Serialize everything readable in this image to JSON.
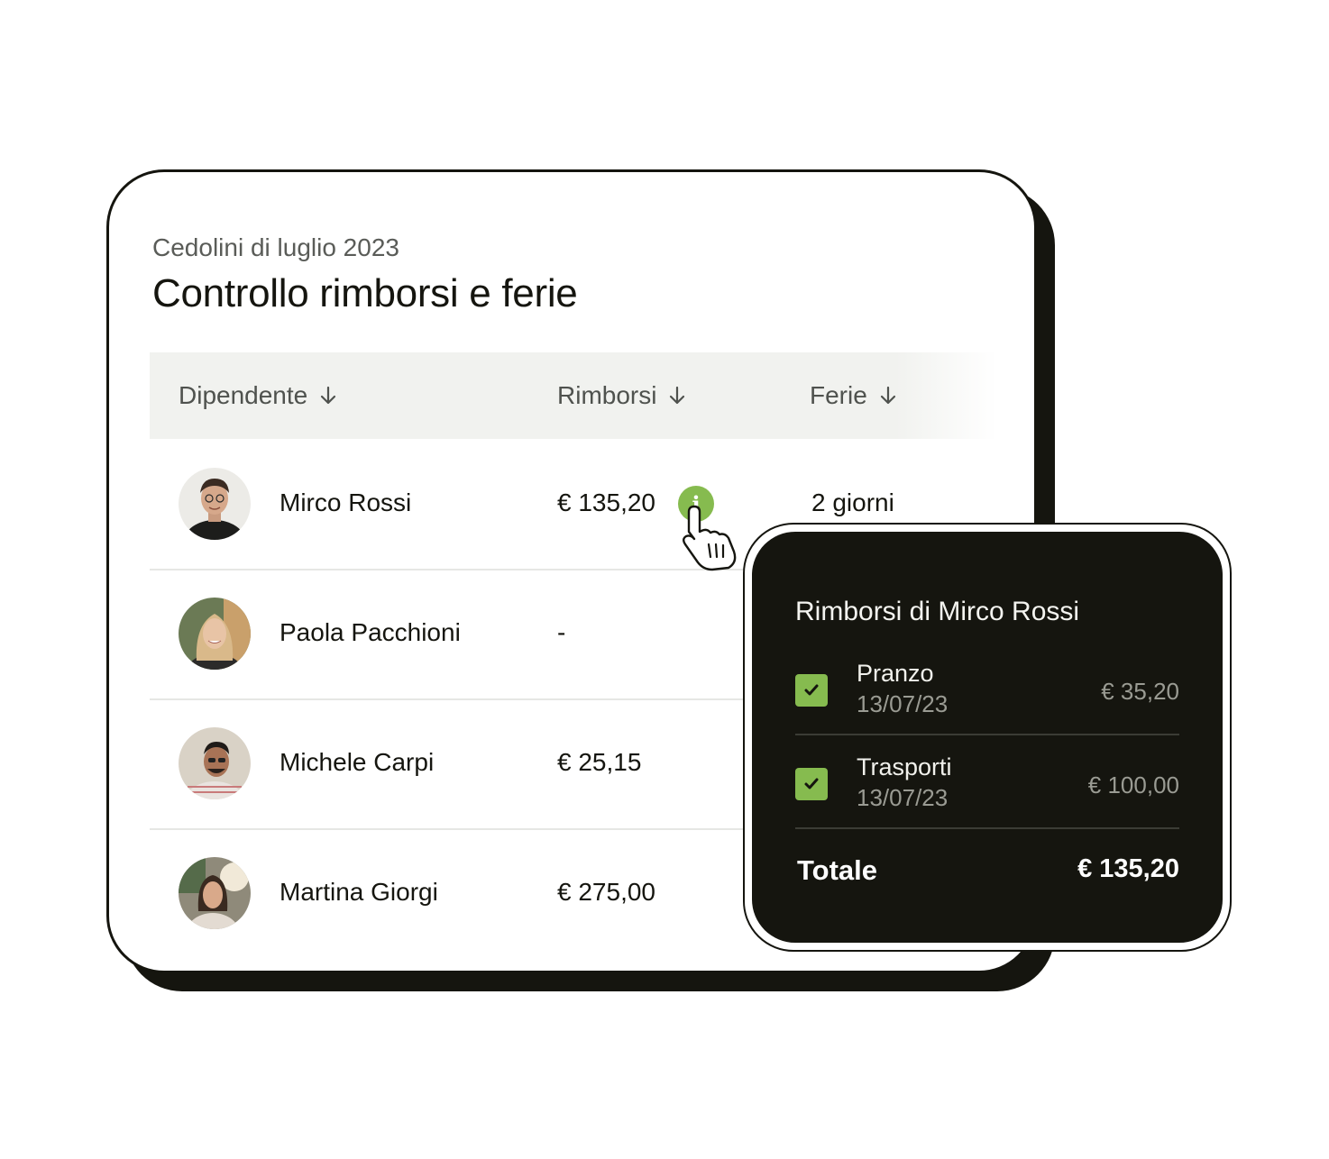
{
  "card": {
    "subtitle": "Cedolini di luglio 2023",
    "title": "Controllo rimborsi e ferie"
  },
  "table": {
    "headers": {
      "employee": "Dipendente",
      "reimbursements": "Rimborsi",
      "holidays": "Ferie",
      "sort_icon": "arrow-down-icon"
    },
    "rows": [
      {
        "name": "Mirco Rossi",
        "reimbursement": "€ 135,20",
        "holidays": "2 giorni",
        "avatar": "avatar-photo"
      },
      {
        "name": "Paola Pacchioni",
        "reimbursement": "-",
        "holidays": "",
        "avatar": "avatar-photo"
      },
      {
        "name": "Michele Carpi",
        "reimbursement": "€ 25,15",
        "holidays": "",
        "avatar": "avatar-photo"
      },
      {
        "name": "Martina Giorgi",
        "reimbursement": "€ 275,00",
        "holidays": "",
        "avatar": "avatar-photo"
      }
    ],
    "info_badge": "i"
  },
  "popup": {
    "title": "Rimborsi di Mirco Rossi",
    "items": [
      {
        "label": "Pranzo",
        "date": "13/07/23",
        "amount": "€ 35,20",
        "checked": true
      },
      {
        "label": "Trasporti",
        "date": "13/07/23",
        "amount": "€ 100,00",
        "checked": true
      }
    ],
    "total_label": "Totale",
    "total_value": "€ 135,20"
  },
  "colors": {
    "accent_green": "#86bb4f",
    "dark": "#15150f",
    "header_bg": "#f1f2ef"
  }
}
